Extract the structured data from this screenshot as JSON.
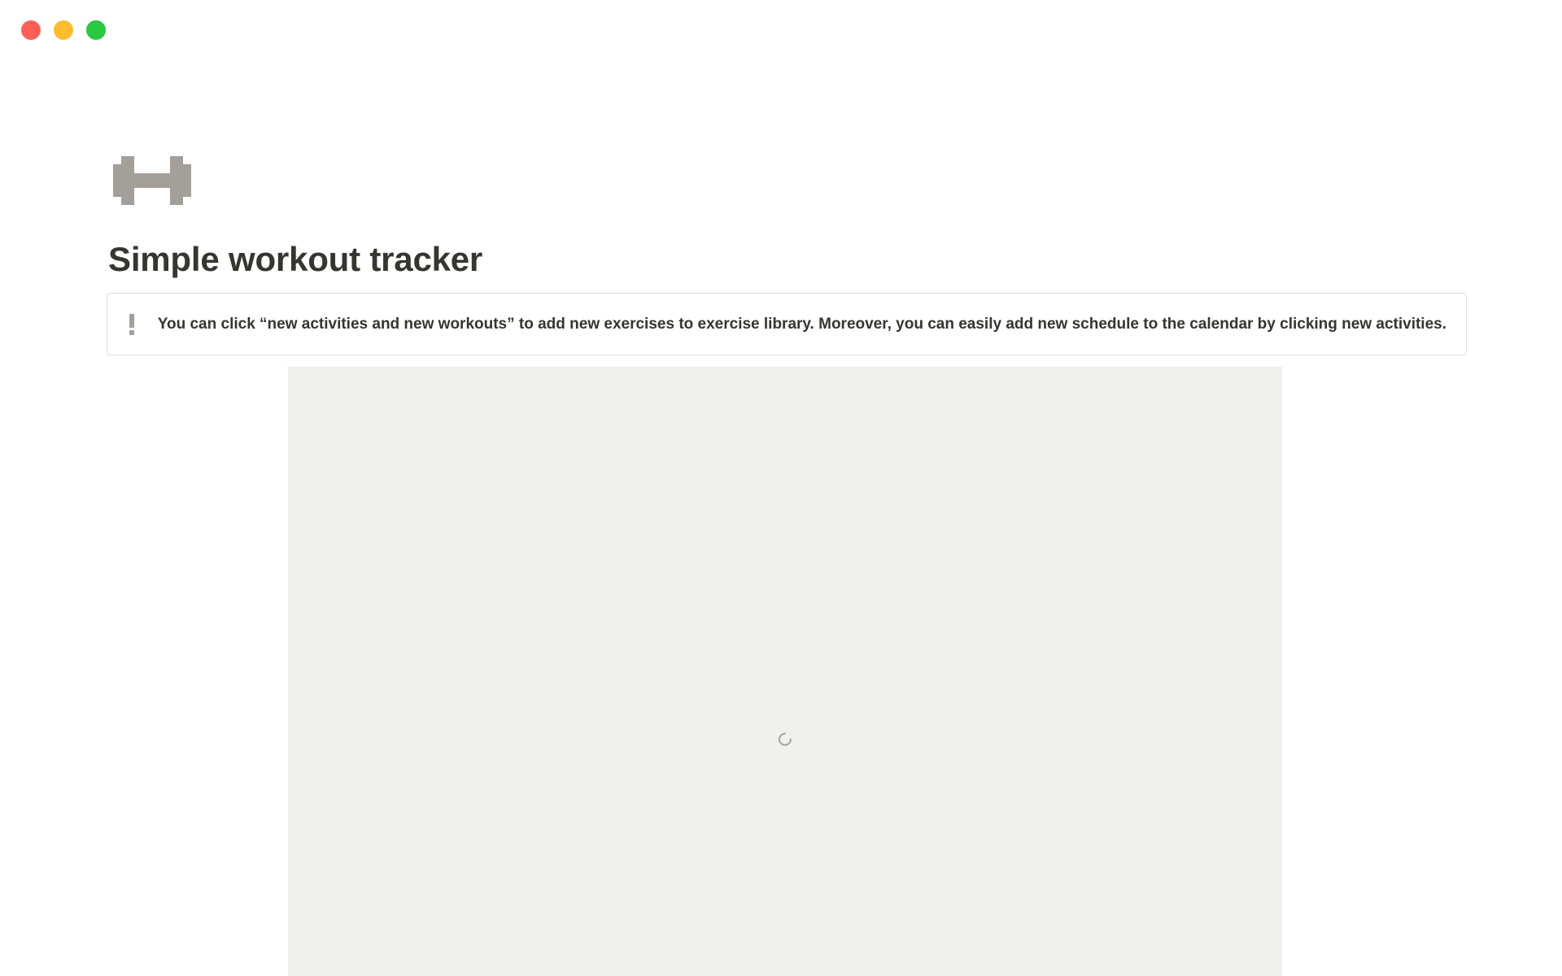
{
  "window": {
    "controls": [
      "close",
      "minimize",
      "zoom"
    ]
  },
  "page": {
    "icon": "dumbbell-icon",
    "title": "Simple workout tracker",
    "callout": {
      "icon": "exclamation-icon",
      "text": "You can click “new activities and new workouts” to add new exercises to exercise library. Moreover, you can easily add new schedule to the calendar by clicking new activities."
    },
    "embed": {
      "state": "loading",
      "icon": "loading-spinner-icon"
    }
  },
  "colors": {
    "close": "#ff5f57",
    "minimize": "#febc2e",
    "zoom": "#28c840",
    "icon_gray": "#a49f98",
    "text": "#37352f",
    "embed_bg": "#f1f0ed"
  }
}
